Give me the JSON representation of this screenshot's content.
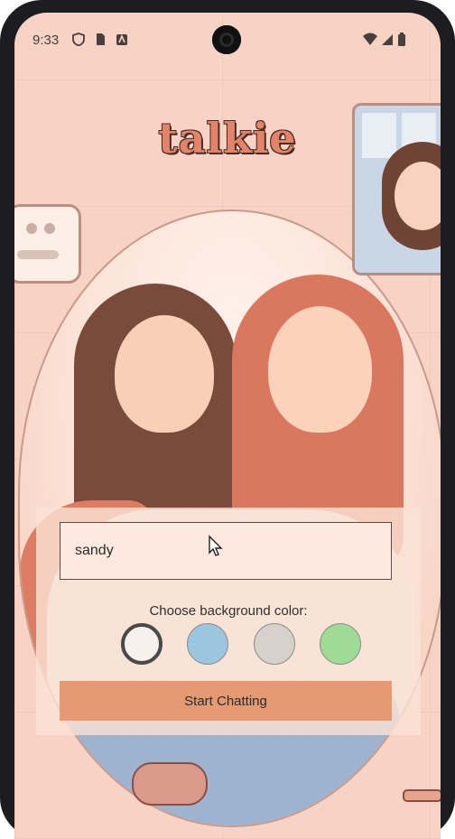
{
  "status_bar": {
    "time": "9:33"
  },
  "app": {
    "logo": "talkie"
  },
  "form": {
    "name_value": "sandy",
    "choose_label": "Choose background color:",
    "swatches": [
      {
        "color": "#f7f1ec",
        "selected": true
      },
      {
        "color": "#9cc6e0",
        "selected": false
      },
      {
        "color": "#d6d2cb",
        "selected": false
      },
      {
        "color": "#9ddb97",
        "selected": false
      }
    ],
    "start_label": "Start Chatting"
  },
  "colors": {
    "accent": "#e59a72",
    "background": "#f6d3c4"
  }
}
